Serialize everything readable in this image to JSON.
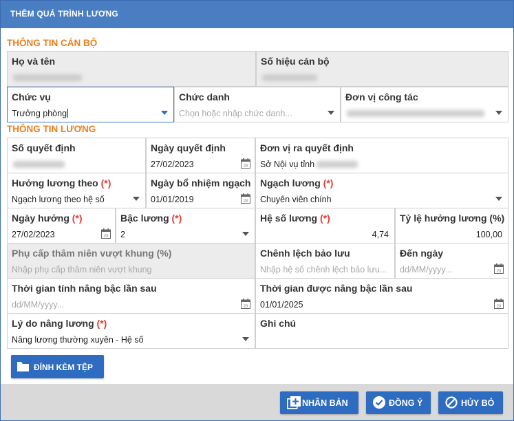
{
  "dialog": {
    "title": "THÊM QUÁ TRÌNH LƯƠNG"
  },
  "section_staff": "THÔNG TIN CÁN BỘ",
  "section_salary": "THÔNG TIN LƯƠNG",
  "fields": {
    "ho_ten": {
      "label": "Họ và tên"
    },
    "so_hieu": {
      "label": "Số hiệu cán bộ"
    },
    "chuc_vu": {
      "label": "Chức vụ",
      "value": "Trưởng phòng"
    },
    "chuc_danh": {
      "label": "Chức danh",
      "placeholder": "Chọn hoặc nhập chức danh..."
    },
    "don_vi": {
      "label": "Đơn vị công tác"
    },
    "so_quyet_dinh": {
      "label": "Số quyết định"
    },
    "ngay_quyet_dinh": {
      "label": "Ngày quyết định",
      "value": "27/02/2023"
    },
    "don_vi_ra_qd": {
      "label": "Đơn vị ra quyết định",
      "value": "Sở Nội vụ tỉnh"
    },
    "huong_luong_theo": {
      "label": "Hưởng lương theo",
      "required": "(*)",
      "value": "Ngạch lương theo hệ số"
    },
    "ngay_bo_nhiem": {
      "label": "Ngày bổ nhiệm ngạch",
      "value": "01/01/2019"
    },
    "ngach_luong": {
      "label": "Ngạch lương",
      "required": "(*)",
      "value": "Chuyên viên chính"
    },
    "ngay_huong": {
      "label": "Ngày hưởng",
      "required": "(*)",
      "value": "27/02/2023"
    },
    "bac_luong": {
      "label": "Bậc lương",
      "required": "(*)",
      "value": "2"
    },
    "he_so_luong": {
      "label": "Hệ số lương",
      "required": "(*)",
      "value": "4,74"
    },
    "ty_le": {
      "label": "Tỷ lệ hưởng lương (%)",
      "value": "100,00"
    },
    "phu_cap": {
      "label": "Phụ cấp thâm niên vượt khung (%)",
      "placeholder": "Nhập phụ cấp thâm niên vượt khung"
    },
    "chenh_lech": {
      "label": "Chênh lệch bảo lưu",
      "placeholder": "Nhập hệ số chênh lệch bảo lưu..."
    },
    "den_ngay": {
      "label": "Đến ngày",
      "placeholder": "dd/MM/yyyy..."
    },
    "tg_nang_bac": {
      "label": "Thời gian tính nâng bậc lần sau",
      "placeholder": "dd/MM/yyyy..."
    },
    "tg_duoc_nang": {
      "label": "Thời gian được nâng bậc lần sau",
      "value": "01/01/2025"
    },
    "ly_do": {
      "label": "Lý do nâng lương",
      "required": "(*)",
      "value": "Nâng lương thường xuyên - Hệ số"
    },
    "ghi_chu": {
      "label": "Ghi chú"
    }
  },
  "buttons": {
    "attach": "ĐÍNH KÈM TỆP",
    "duplicate": "NHÂN BẢN",
    "agree": "ĐỒNG Ý",
    "cancel": "HỦY BỎ"
  },
  "colors": {
    "accent": "#2d6cc0",
    "title_bar": "#4a7ec2",
    "section": "#f07d1a",
    "required": "#e03c31"
  }
}
